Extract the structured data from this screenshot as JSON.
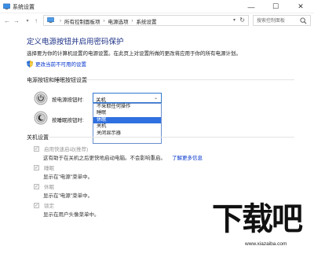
{
  "window": {
    "title": "系统设置",
    "controls": {
      "minimize": "—",
      "maximize": "☐",
      "close": "✕"
    }
  },
  "address": {
    "crumbs": [
      "所有控制面板项",
      "电源选项",
      "系统设置"
    ],
    "search_placeholder": "搜索控制面板"
  },
  "page": {
    "heading": "定义电源按钮并启用密码保护",
    "subtext": "选择要为你的计算机设置的电源设置。在此页上对设置所做的更改将应用于你的所有电源计划。",
    "change_link": "更改当前不可用的设置"
  },
  "power_section": {
    "title": "电源按钮和睡眠按钮设置",
    "rows": [
      {
        "label": "按电源按钮时:",
        "selected": "关机"
      },
      {
        "label": "按睡眠按钮时:"
      }
    ],
    "dropdown_options": [
      "不采取任何操作",
      "睡眠",
      "休眠",
      "关机",
      "关闭显示器"
    ],
    "dropdown_selected_index": 2
  },
  "shutdown_section": {
    "title": "关机设置",
    "items": [
      {
        "label": "启用快速启动(推荐)",
        "checked": true,
        "desc": "这有助于在关机之后更快地启动电脑。不会影响重启。",
        "link": "了解更多信息"
      },
      {
        "label": "睡眠",
        "checked": true,
        "desc": "显示在\"电源\"菜单中。"
      },
      {
        "label": "休眠",
        "checked": true,
        "desc": "显示在\"电源\"菜单中。"
      },
      {
        "label": "锁定",
        "checked": true,
        "desc": "显示在用户头像菜单中。"
      }
    ]
  },
  "watermark": {
    "text": "下载吧",
    "url": "www.xiazaiba.com"
  },
  "colors": {
    "heading": "#1e3287",
    "link": "#0033cc",
    "selection": "#3070e0"
  }
}
